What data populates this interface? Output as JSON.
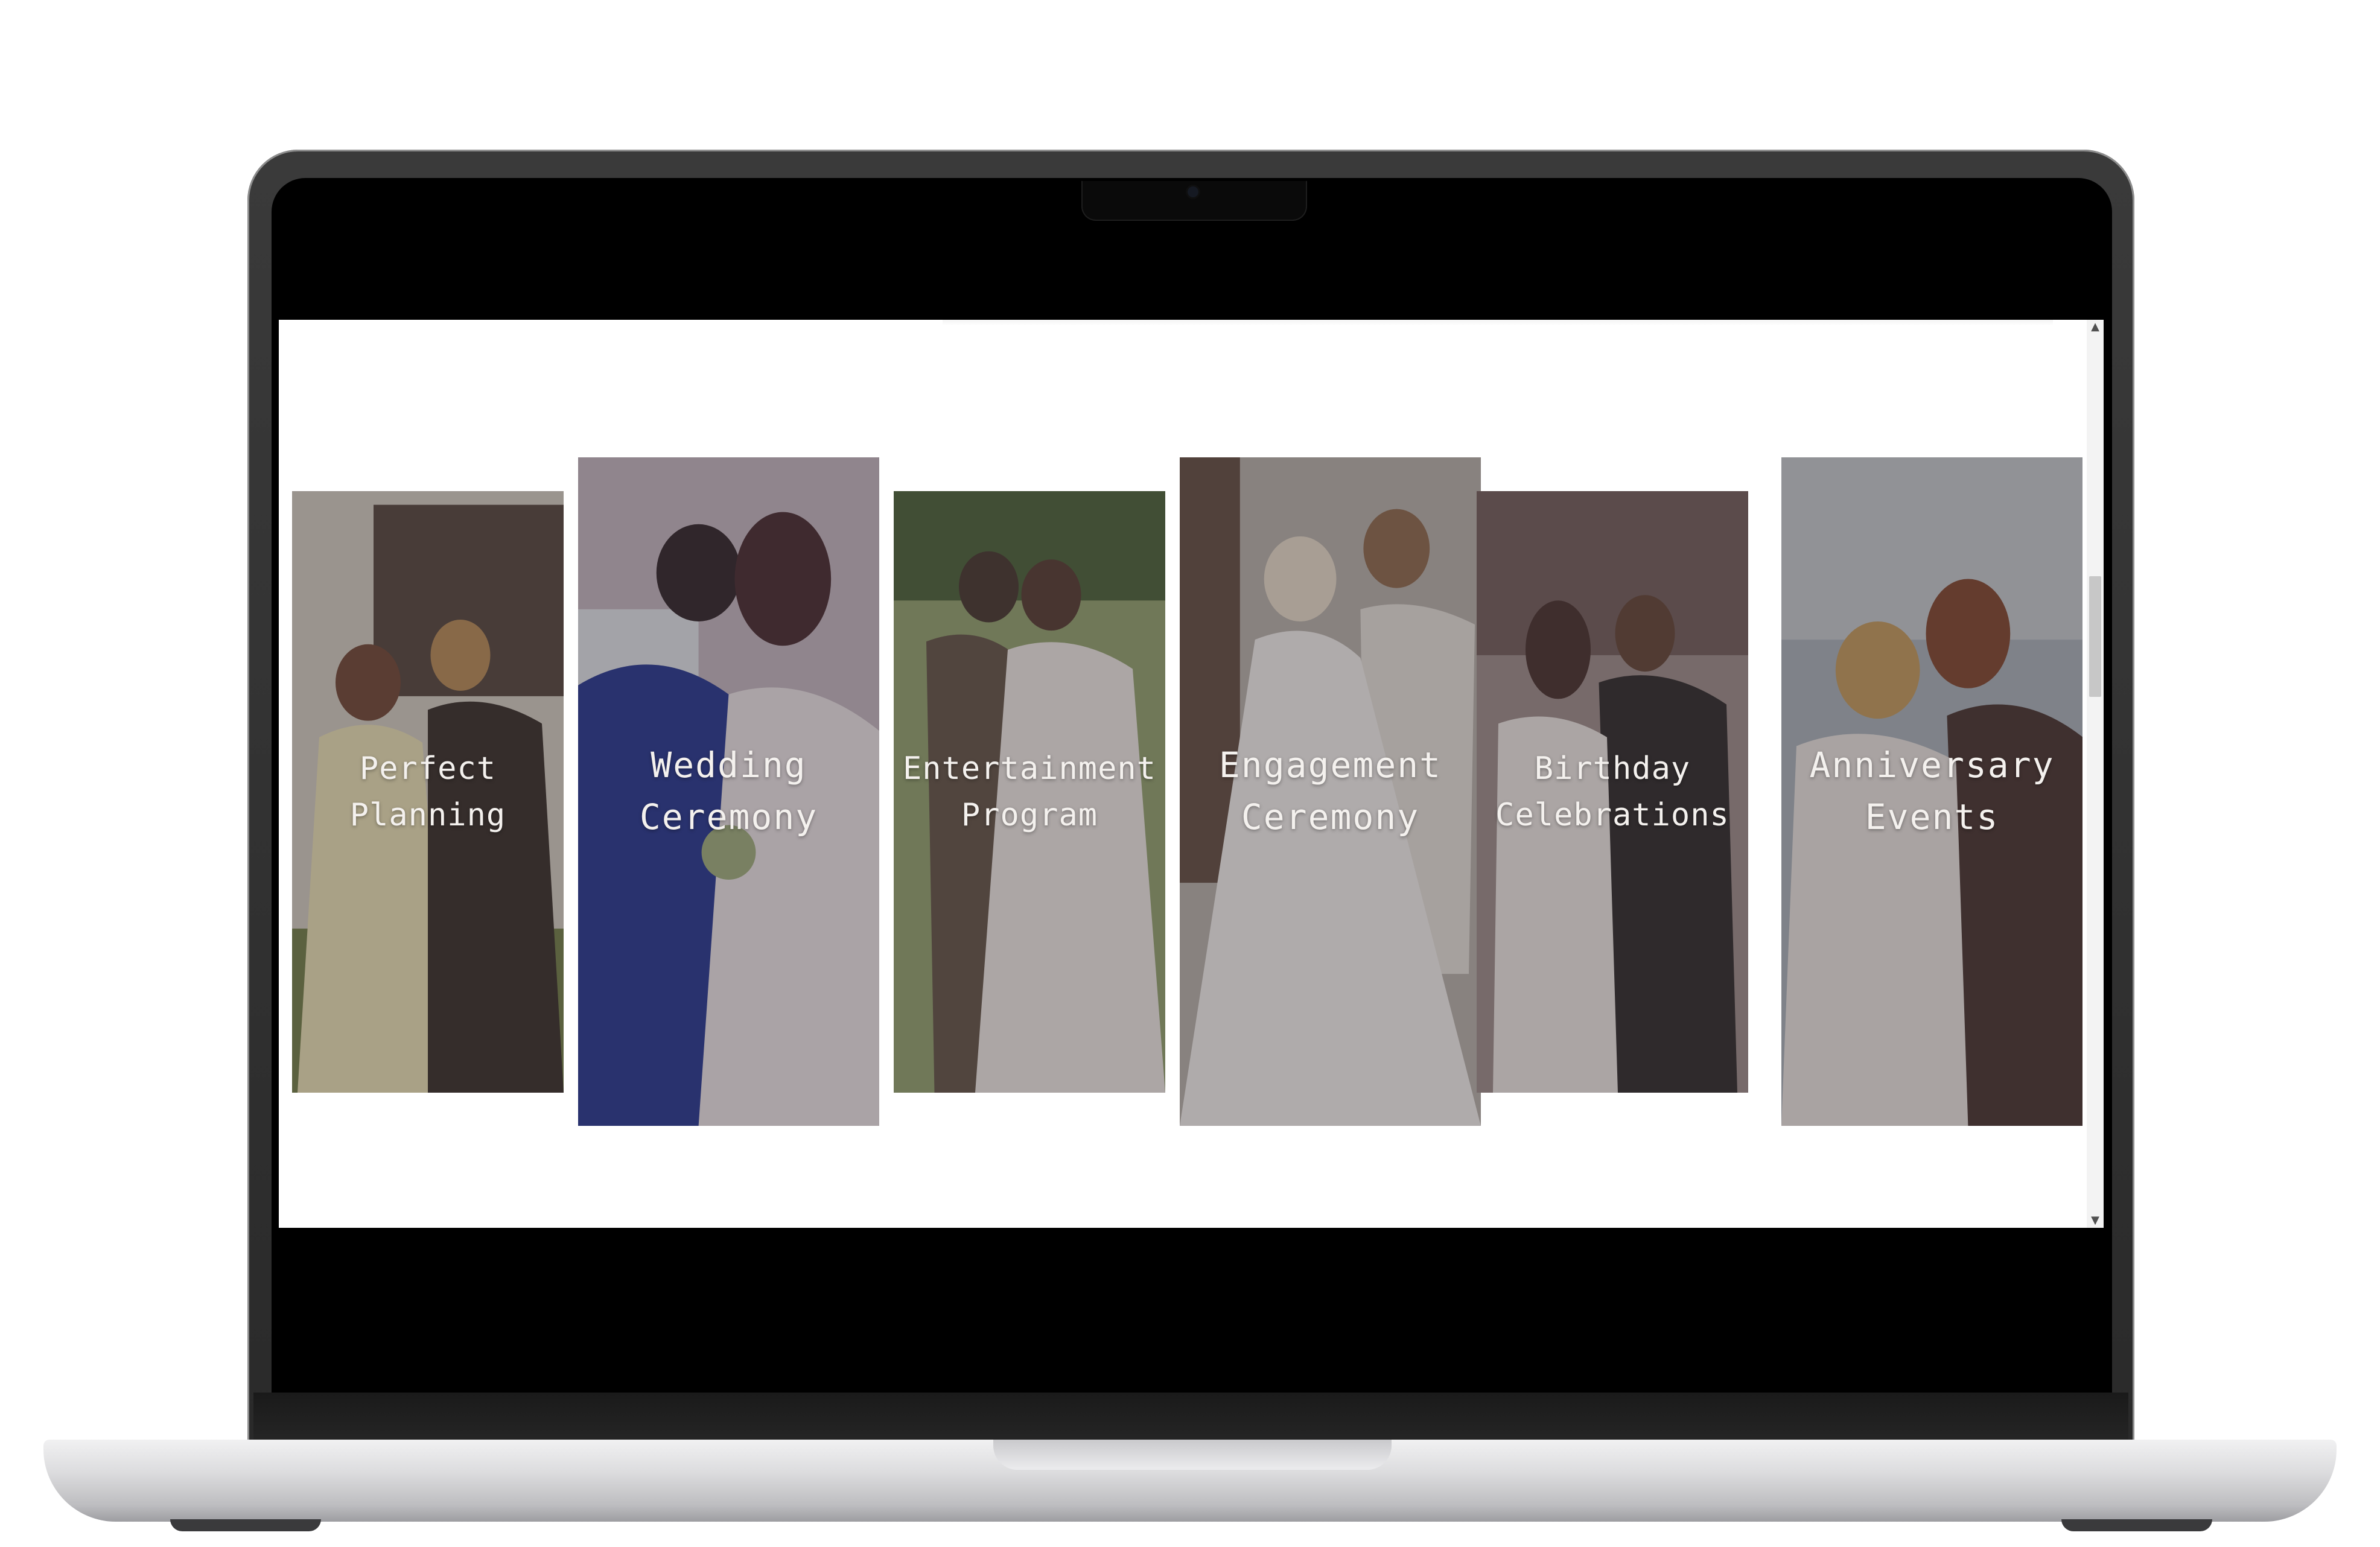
{
  "screen": {
    "cards": [
      {
        "line1": "Perfect",
        "line2": "Planning"
      },
      {
        "line1": "Wedding",
        "line2": "Ceremony"
      },
      {
        "line1": "Entertainment",
        "line2": "Program"
      },
      {
        "line1": "Engagement",
        "line2": "Ceremony"
      },
      {
        "line1": "Birthday",
        "line2": "Celebrations"
      },
      {
        "line1": "Anniversary",
        "line2": "Events"
      }
    ],
    "scrollbar": {
      "up_icon": "▲",
      "down_icon": "▼"
    }
  },
  "colors": {
    "overlay": "#463e40",
    "title_text": "#f4f1ee",
    "screen_bg": "#ffffff",
    "laptop_body": "#2a2a2a",
    "laptop_base": "#dcdcde"
  }
}
